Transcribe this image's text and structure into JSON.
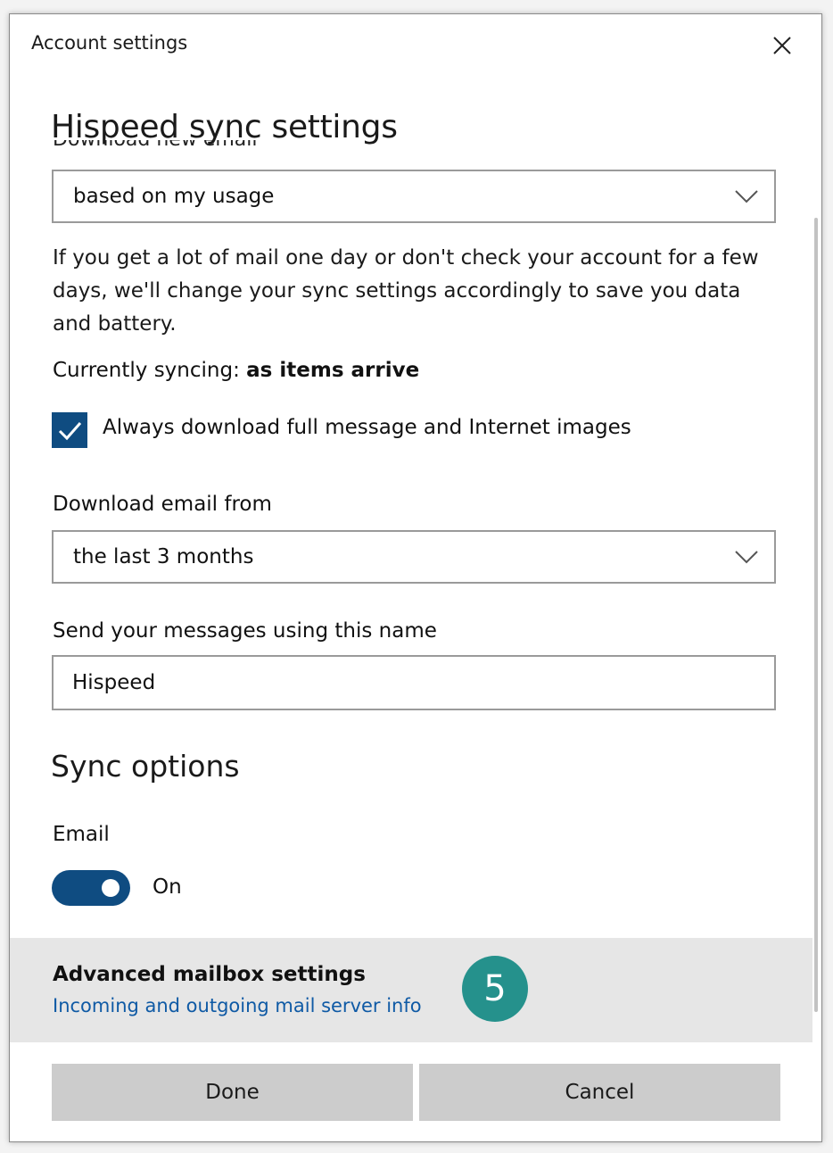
{
  "window": {
    "title": "Account settings"
  },
  "heading": "Hispeed sync settings",
  "peek_label": "Download new email",
  "download_new": {
    "selected": "based on my usage"
  },
  "description": "If you get a lot of mail one day or don't check your account for a few days, we'll change your sync settings accordingly to save you data and battery.",
  "status": {
    "prefix": "Currently syncing: ",
    "value": "as items arrive"
  },
  "full_message_checkbox": {
    "checked": true,
    "label": "Always download full message and Internet images"
  },
  "download_from": {
    "label": "Download email from",
    "selected": "the last 3 months"
  },
  "send_name": {
    "label": "Send your messages using this name",
    "value": "Hispeed"
  },
  "sync_options": {
    "heading": "Sync options",
    "email_label": "Email",
    "toggle_state": "On",
    "toggle_on": true
  },
  "advanced": {
    "title": "Advanced mailbox settings",
    "link": "Incoming and outgoing mail server info",
    "badge": "5"
  },
  "buttons": {
    "done": "Done",
    "cancel": "Cancel"
  },
  "colors": {
    "accent": "#0f4c81",
    "badge": "#25918c",
    "link": "#0f5aa5"
  }
}
